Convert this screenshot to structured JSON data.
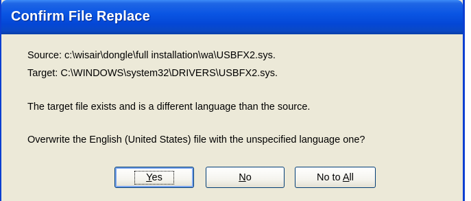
{
  "window": {
    "title": "Confirm File Replace"
  },
  "message": {
    "source_line": "Source: c:\\wisair\\dongle\\full installation\\wa\\USBFX2.sys.",
    "target_line": "Target: C:\\WINDOWS\\system32\\DRIVERS\\USBFX2.sys.",
    "info_line": "The target file exists and is a different language than the source.",
    "question_line": "Overwrite the English (United States) file with the unspecified language one?"
  },
  "buttons": {
    "yes": {
      "accel": "Y",
      "rest": "es"
    },
    "no": {
      "accel": "N",
      "rest": "o"
    },
    "no_to_all": {
      "prefix": "No to ",
      "accel": "A",
      "rest": "ll"
    }
  }
}
